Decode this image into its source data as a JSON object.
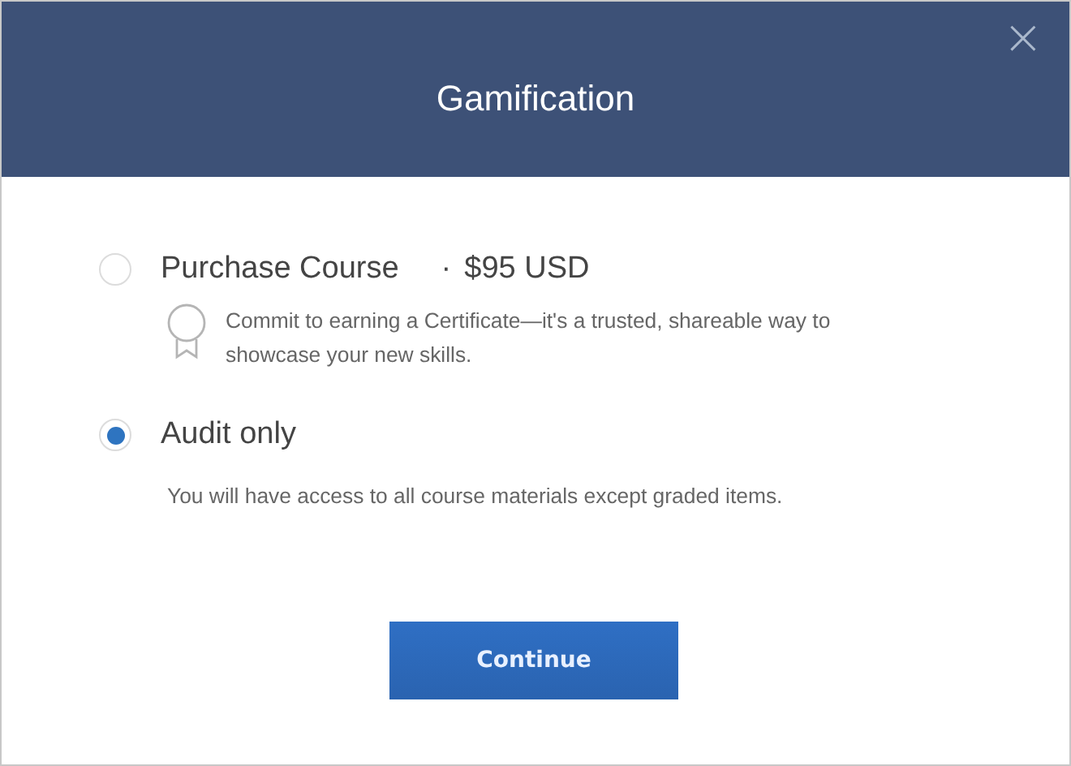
{
  "dialog": {
    "title": "Gamification",
    "close": "×"
  },
  "options": [
    {
      "kind": "certificate",
      "label": "Purchase Course",
      "separator": "·",
      "price": "$95 USD",
      "description": "Commit to earning a Certificate—it's a trusted, shareable way to showcase your new skills.",
      "selected": false
    },
    {
      "kind": "plain",
      "label": "Audit only",
      "description": "You will have access to all course materials except graded items.",
      "selected": true
    }
  ],
  "button": "Continue"
}
